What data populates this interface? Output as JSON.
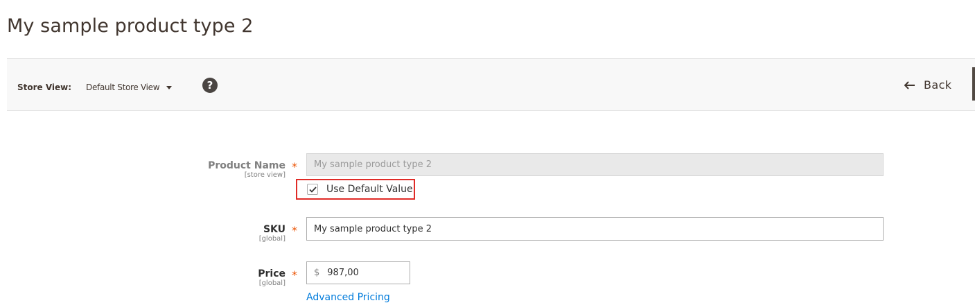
{
  "page": {
    "title": "My sample product type 2"
  },
  "toolbar": {
    "store_view_label": "Store View:",
    "store_view_value": "Default Store View",
    "help_symbol": "?",
    "back_label": "Back"
  },
  "form": {
    "product_name": {
      "label": "Product Name",
      "scope": "[store view]",
      "required_mark": "*",
      "value": "My sample product type 2",
      "use_default_label": "Use Default Value",
      "use_default_checked": true
    },
    "sku": {
      "label": "SKU",
      "scope": "[global]",
      "required_mark": "*",
      "value": "My sample product type 2"
    },
    "price": {
      "label": "Price",
      "scope": "[global]",
      "required_mark": "*",
      "currency_symbol": "$",
      "value": "987,00",
      "advanced_link": "Advanced Pricing"
    }
  },
  "colors": {
    "accent_link": "#007bdb",
    "required": "#eb5202",
    "highlight_border": "#e02b27"
  }
}
